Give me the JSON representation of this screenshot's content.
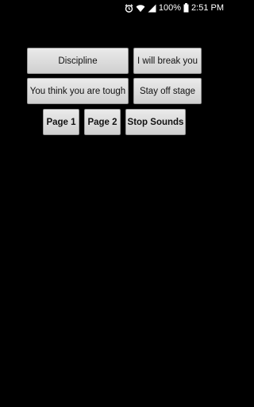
{
  "status_bar": {
    "battery_percent": "100%",
    "time": "2:51 PM",
    "icons": [
      "alarm-icon",
      "wifi-icon",
      "cellular-signal-icon",
      "battery-icon"
    ]
  },
  "buttons": {
    "discipline": "Discipline",
    "break_you": "I will break you",
    "think_tough": "You think you are tough",
    "stay_off_stage": "Stay off stage",
    "page1": "Page 1",
    "page2": "Page 2",
    "stop_sounds": "Stop Sounds"
  },
  "colors": {
    "background": "#000000",
    "button_face": "#dcdcdc",
    "button_text": "#111111"
  }
}
